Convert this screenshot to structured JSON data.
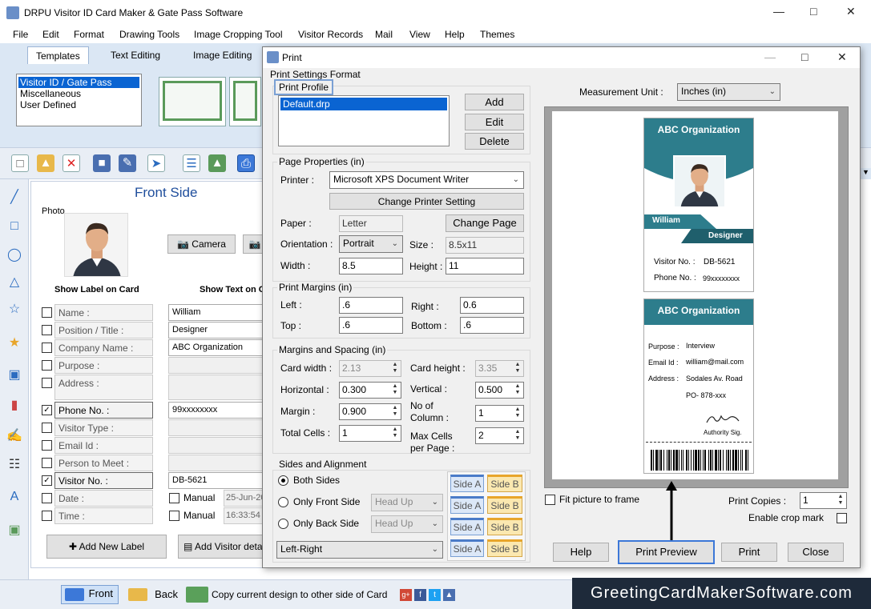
{
  "app": {
    "title": "DRPU Visitor ID Card Maker & Gate Pass Software",
    "menu": [
      "File",
      "Edit",
      "Format",
      "Drawing Tools",
      "Image Cropping Tool",
      "Visitor Records",
      "Mail",
      "View",
      "Help",
      "Themes"
    ],
    "tabs": [
      "Templates",
      "Text Editing",
      "Image Editing"
    ],
    "template_categories": [
      "Visitor ID / Gate Pass",
      "Miscellaneous",
      "User Defined"
    ]
  },
  "editor": {
    "front_side_title": "Front Side",
    "photo_label": "Photo",
    "camera_button": "Camera",
    "show_label_header": "Show Label on Card",
    "show_text_header": "Show Text on C",
    "fields": [
      {
        "label": "Name :",
        "checked": false,
        "value": "William",
        "enabled": true
      },
      {
        "label": "Position / Title :",
        "checked": false,
        "value": "Designer",
        "enabled": true
      },
      {
        "label": "Company Name :",
        "checked": false,
        "value": "ABC Organization",
        "enabled": true
      },
      {
        "label": "Purpose :",
        "checked": false,
        "value": "",
        "enabled": false
      },
      {
        "label": "Address :",
        "checked": false,
        "value": "",
        "enabled": false
      },
      {
        "label": "Phone No. :",
        "checked": true,
        "value": "99xxxxxxxx",
        "enabled": true
      },
      {
        "label": "Visitor Type :",
        "checked": false,
        "value": "",
        "enabled": false
      },
      {
        "label": "Email Id :",
        "checked": false,
        "value": "",
        "enabled": false
      },
      {
        "label": "Person to Meet :",
        "checked": false,
        "value": "",
        "enabled": false
      },
      {
        "label": "Visitor No. :",
        "checked": true,
        "value": "DB-5621",
        "enabled": true
      },
      {
        "label": "Date :",
        "checked": false,
        "value": "25-Jun-20",
        "enabled": false,
        "manual": "Manual"
      },
      {
        "label": "Time :",
        "checked": false,
        "value": "16:33:54",
        "enabled": false,
        "manual": "Manual"
      }
    ],
    "add_new_label_button": "Add New Label",
    "add_visitor_button": "Add Visitor detai"
  },
  "status": {
    "front_button": "Front",
    "back_button": "Back",
    "copy_text": "Copy current design to other side of Card",
    "watermark": "GreetingCardMakerSoftware.com"
  },
  "print": {
    "title": "Print",
    "settings_format": "Print Settings Format",
    "print_profile": "Print Profile",
    "profiles": [
      "Default.drp"
    ],
    "add_button": "Add",
    "edit_button": "Edit",
    "delete_button": "Delete",
    "page_properties": "Page Properties  (in)",
    "printer_label": "Printer :",
    "printer_value": "Microsoft XPS Document Writer",
    "change_printer_button": "Change Printer Setting",
    "paper_label": "Paper :",
    "paper_value": "Letter",
    "change_page_button": "Change Page",
    "orientation_label": "Orientation :",
    "orientation_value": "Portrait",
    "size_label": "Size :",
    "size_value": "8.5x11",
    "width_label": "Width :",
    "width_value": "8.5",
    "height_label": "Height :",
    "height_value": "11",
    "print_margins": "Print Margins (in)",
    "left_label": "Left :",
    "left_value": ".6",
    "right_label": "Right :",
    "right_value": "0.6",
    "top_label": "Top :",
    "top_value": ".6",
    "bottom_label": "Bottom :",
    "bottom_value": ".6",
    "margins_spacing": "Margins and Spacing  (in)",
    "card_width_label": "Card width :",
    "card_width_value": "2.13",
    "card_height_label": "Card height :",
    "card_height_value": "3.35",
    "horizontal_label": "Horizontal :",
    "horizontal_value": "0.300",
    "vertical_label": "Vertical :",
    "vertical_value": "0.500",
    "margin_label": "Margin :",
    "margin_value": "0.900",
    "no_of_column_label": "No of Column :",
    "no_of_column_value": "1",
    "total_cells_label": "Total Cells :",
    "total_cells_value": "1",
    "max_cells_label": "Max Cells per Page :",
    "max_cells_value": "2",
    "sides_alignment": "Sides and Alignment",
    "both_sides": "Both Sides",
    "only_front_side": "Only Front Side",
    "only_back_side": "Only Back Side",
    "head_up": "Head Up",
    "alignment_value": "Left-Right",
    "side_a": "Side A",
    "side_b": "Side B",
    "measurement_unit_label": "Measurement Unit :",
    "measurement_unit_value": "Inches (in)",
    "fit_picture": "Fit picture to frame",
    "print_copies_label": "Print Copies :",
    "print_copies_value": "1",
    "enable_crop_mark": "Enable crop mark",
    "help_button": "Help",
    "print_preview_button": "Print Preview",
    "print_button": "Print",
    "close_button": "Close"
  },
  "card_front": {
    "org": "ABC Organization",
    "name": "William",
    "designation": "Designer",
    "visitor_no_label": "Visitor No. :",
    "visitor_no_value": "DB-5621",
    "phone_label": "Phone No. :",
    "phone_value": "99xxxxxxxx"
  },
  "card_back": {
    "org": "ABC Organization",
    "purpose_label": "Purpose :",
    "purpose_value": "Interview",
    "email_label": "Email Id :",
    "email_value": "william@mail.com",
    "address_label": "Address :",
    "address_line1": "Sodales Av. Road",
    "address_line2": "PO- 878-xxx",
    "signature_label": "Authority Sig."
  },
  "colors": {
    "card_teal": "#2d7d8c",
    "card_dark": "#1f5f6c",
    "accent_blue": "#3c78d8"
  }
}
